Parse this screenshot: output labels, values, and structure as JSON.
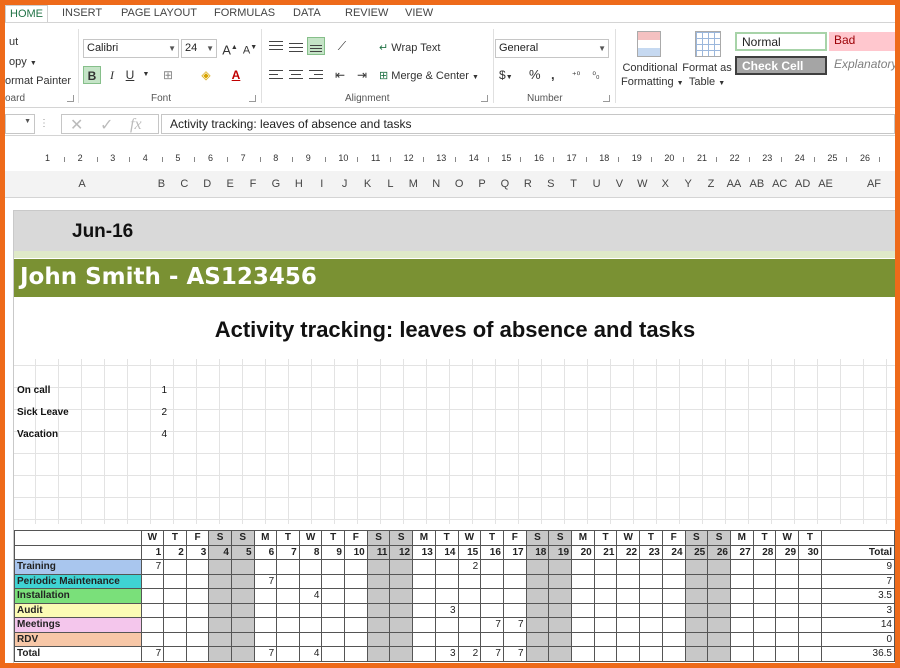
{
  "ribbon": {
    "tabs": [
      "HOME",
      "INSERT",
      "PAGE LAYOUT",
      "FORMULAS",
      "DATA",
      "REVIEW",
      "VIEW"
    ],
    "clipboard": {
      "cut": "ut",
      "copy": "opy",
      "format_painter": "ormat Painter",
      "group": "oard"
    },
    "font": {
      "name": "Calibri",
      "size": "24",
      "group": "Font"
    },
    "alignment": {
      "wrap_text": "Wrap Text",
      "merge_center": "Merge & Center",
      "group": "Alignment"
    },
    "number": {
      "format": "General",
      "group": "Number",
      "currency": "$",
      "percent": "%",
      "comma": ","
    },
    "styles": {
      "conditional": "Conditional",
      "conditional2": "Formatting",
      "format_as": "Format as",
      "table": "Table",
      "normal": "Normal",
      "bad": "Bad",
      "check_cell": "Check Cell",
      "explanatory": "Explanatory"
    }
  },
  "formula_bar": {
    "content": "Activity tracking: leaves of absence and tasks"
  },
  "ruler": [
    "1",
    "2",
    "3",
    "4",
    "5",
    "6",
    "7",
    "8",
    "9",
    "10",
    "11",
    "12",
    "13",
    "14",
    "15",
    "16",
    "17",
    "18",
    "19",
    "20",
    "21",
    "22",
    "23",
    "24",
    "25",
    "26"
  ],
  "columns": [
    "A",
    "B",
    "C",
    "D",
    "E",
    "F",
    "G",
    "H",
    "I",
    "J",
    "K",
    "L",
    "M",
    "N",
    "O",
    "P",
    "Q",
    "R",
    "S",
    "T",
    "U",
    "V",
    "W",
    "X",
    "Y",
    "Z",
    "AA",
    "AB",
    "AC",
    "AD",
    "AE",
    "AF"
  ],
  "sheet": {
    "month": "Jun-16",
    "employee": "John Smith -  AS123456",
    "title": "Activity tracking: leaves of absence and tasks",
    "legend": [
      {
        "label": "On call",
        "value": "1"
      },
      {
        "label": "Sick Leave",
        "value": "2"
      },
      {
        "label": "Vacation",
        "value": "4"
      }
    ],
    "calendar": {
      "dow": [
        "W",
        "T",
        "F",
        "S",
        "S",
        "M",
        "T",
        "W",
        "T",
        "F",
        "S",
        "S",
        "M",
        "T",
        "W",
        "T",
        "F",
        "S",
        "S",
        "M",
        "T",
        "W",
        "T",
        "F",
        "S",
        "S",
        "M",
        "T",
        "W",
        "T"
      ],
      "days": [
        "1",
        "2",
        "3",
        "4",
        "5",
        "6",
        "7",
        "8",
        "9",
        "10",
        "11",
        "12",
        "13",
        "14",
        "15",
        "16",
        "17",
        "18",
        "19",
        "20",
        "21",
        "22",
        "23",
        "24",
        "25",
        "26",
        "27",
        "28",
        "29",
        "30"
      ],
      "total_header": "Total",
      "rows": [
        {
          "label": "Training",
          "color": "#a9c6ee",
          "cells": {
            "1": "7",
            "15": "2"
          },
          "total": "9"
        },
        {
          "label": "Periodic Maintenance",
          "color": "#3fd3d3",
          "cells": {
            "6": "7"
          },
          "total": "7"
        },
        {
          "label": "Installation",
          "color": "#7ae07a",
          "cells": {
            "8": "4"
          },
          "total": "3.5"
        },
        {
          "label": "Audit",
          "color": "#fbfbb4",
          "cells": {
            "14": "3"
          },
          "total": "3"
        },
        {
          "label": "Meetings",
          "color": "#f4c6ec",
          "cells": {
            "16": "7",
            "17": "7"
          },
          "total": "14"
        },
        {
          "label": "RDV",
          "color": "#f7c7a7",
          "cells": {},
          "total": "0"
        },
        {
          "label": "Total",
          "color": "#ffffff",
          "cells": {
            "1": "7",
            "6": "7",
            "8": "4",
            "14": "3",
            "15": "2",
            "16": "7",
            "17": "7"
          },
          "total": "36.5"
        }
      ]
    }
  },
  "colors": {
    "accent": "#217346",
    "frame": "#ee6a1a",
    "name_band": "#7a9133",
    "weekend": "#c8c8c8"
  }
}
